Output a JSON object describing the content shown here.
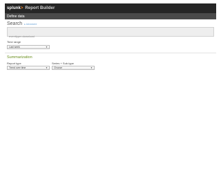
{
  "header": {
    "brand": "splunk",
    "brand_arrow": ">",
    "app_name": "Report Builder"
  },
  "subheader": {
    "title": "Define data"
  },
  "search": {
    "title": "Search",
    "link_text": "▸ Advanced",
    "query": "eventtype=download"
  },
  "time_range": {
    "label": "Time range",
    "selected": "Last week"
  },
  "summarization": {
    "title": "Summarization",
    "report_type_label": "Report type",
    "report_type_selected": "Trend over time",
    "series_label": "Series + Sub-type",
    "series_selected": "Choose"
  },
  "colors": {
    "topbar": "#262626",
    "subbar": "#4a4a4a",
    "brand_arrow": "#f58220",
    "section_title": "#6a8f1f",
    "link": "#6ba4d8"
  }
}
